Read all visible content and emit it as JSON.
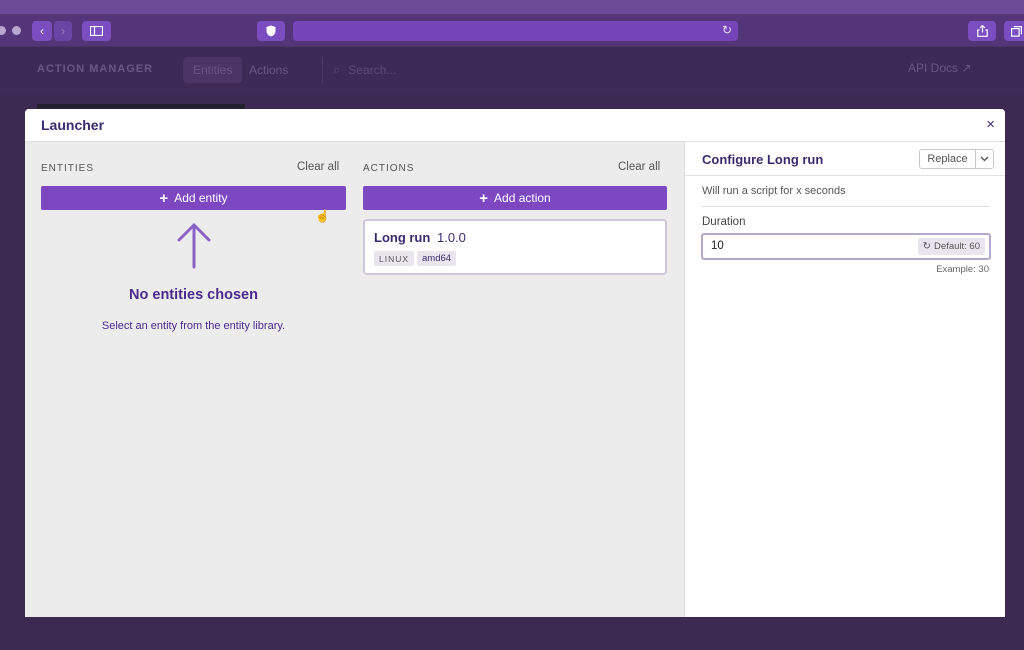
{
  "app": {
    "brand": "ACTION MANAGER",
    "tabs": [
      {
        "label": "Entities"
      },
      {
        "label": "Actions"
      }
    ],
    "search_placeholder": "Search...",
    "api_docs": "API Docs ↗"
  },
  "modal": {
    "title": "Launcher",
    "close_icon": "×",
    "entities": {
      "heading": "ENTITIES",
      "clear_all": "Clear all",
      "add_button": "Add entity",
      "empty_title": "No entities chosen",
      "empty_subtitle": "Select an entity from the entity library."
    },
    "actions": {
      "heading": "ACTIONS",
      "clear_all": "Clear all",
      "add_button": "Add action",
      "items": [
        {
          "name": "Long run",
          "version": "1.0.0",
          "tags": [
            "LINUX",
            "amd64"
          ]
        }
      ]
    },
    "config": {
      "title": "Configure Long run",
      "replace_button": "Replace",
      "description": "Will run a script for x seconds",
      "field_label": "Duration",
      "field_value": "10",
      "default_chip": "Default: 60",
      "example": "Example: 30"
    }
  },
  "colors": {
    "accent": "#7e47c2",
    "title_text": "#3c2a6e",
    "browser_chrome": "#55357a"
  }
}
